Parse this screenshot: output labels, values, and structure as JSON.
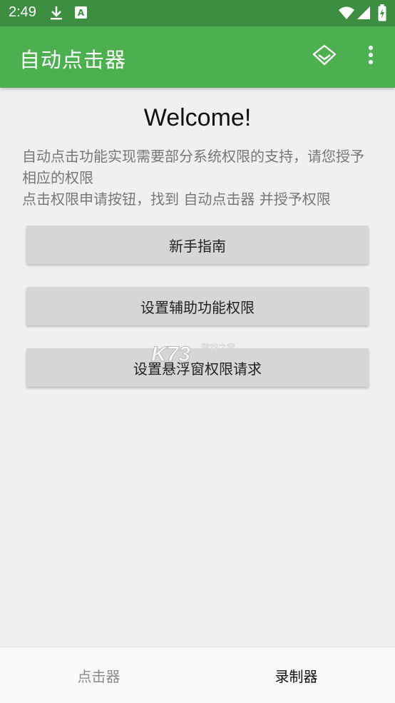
{
  "status_bar": {
    "time": "2:49",
    "icons": [
      "download-icon",
      "font-app-icon",
      "wifi-icon",
      "signal-icon",
      "battery-icon"
    ]
  },
  "app_bar": {
    "title": "自动点击器",
    "actions": [
      "diamond-icon",
      "more-vert-icon"
    ]
  },
  "main": {
    "welcome": "Welcome!",
    "description_line1": "自动点击功能实现需要部分系统权限的支持，请您授予相应的权限",
    "description_line2": "点击权限申请按钮，找到 自动点击器 并授予权限",
    "buttons": [
      {
        "label": "新手指南"
      },
      {
        "label": "设置辅助功能权限"
      },
      {
        "label": "设置悬浮窗权限请求"
      }
    ]
  },
  "watermark": {
    "brand": "K73",
    "tagline": "游戏之家"
  },
  "bottom_nav": {
    "tabs": [
      {
        "label": "点击器",
        "active": false
      },
      {
        "label": "录制器",
        "active": true
      }
    ]
  },
  "colors": {
    "status_bar": "#3e8e41",
    "app_bar": "#4caf50",
    "background": "#f0f0f0",
    "button": "#d6d6d6"
  }
}
